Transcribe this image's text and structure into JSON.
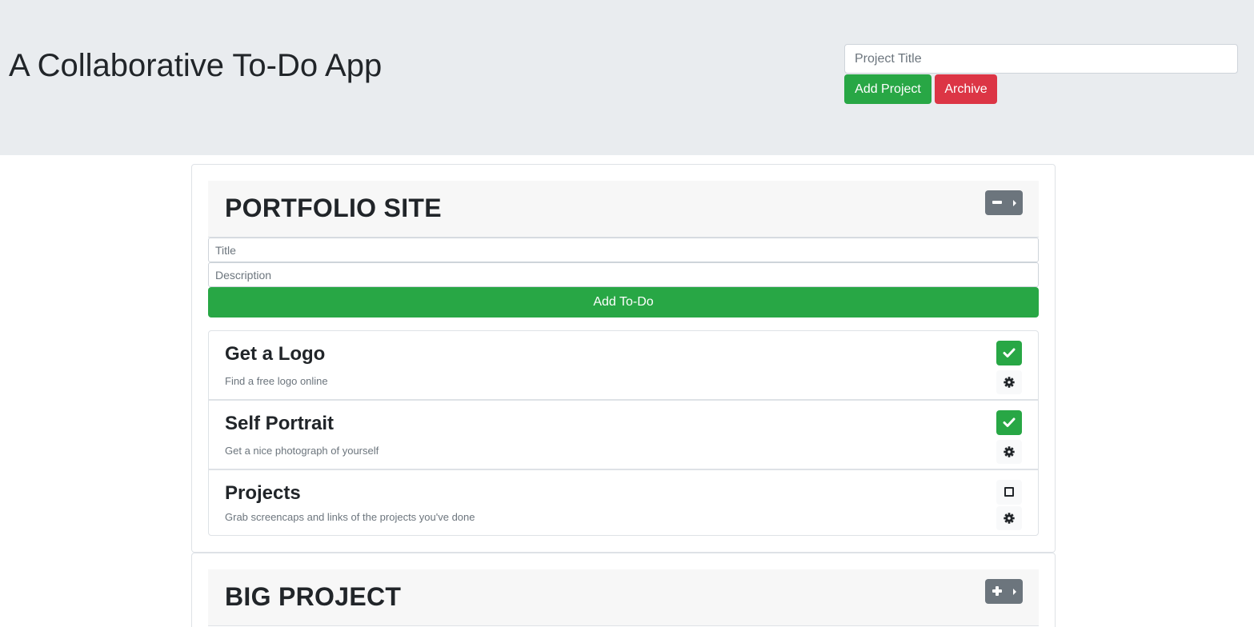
{
  "header": {
    "title": "A Collaborative To-Do App",
    "project_title_placeholder": "Project Title",
    "add_project_label": "Add Project",
    "archive_label": "Archive"
  },
  "projects": [
    {
      "name": "PORTFOLIO SITE",
      "expanded": true,
      "toggle_icon": "minus-icon",
      "form": {
        "title_placeholder": "Title",
        "description_placeholder": "Description",
        "add_todo_label": "Add To-Do"
      },
      "todos": [
        {
          "title": "Get a Logo",
          "description": "Find a free logo online",
          "completed": true
        },
        {
          "title": "Self Portrait",
          "description": "Get a nice photograph of yourself",
          "completed": true
        },
        {
          "title": "Projects",
          "description": "Grab screencaps and links of the projects you've done",
          "completed": false
        }
      ]
    },
    {
      "name": "BIG PROJECT",
      "expanded": false,
      "toggle_icon": "plus-icon"
    }
  ],
  "colors": {
    "success": "#28a745",
    "danger": "#dc3545",
    "secondary": "#6c757d",
    "jumbotron": "#e9ecef"
  }
}
